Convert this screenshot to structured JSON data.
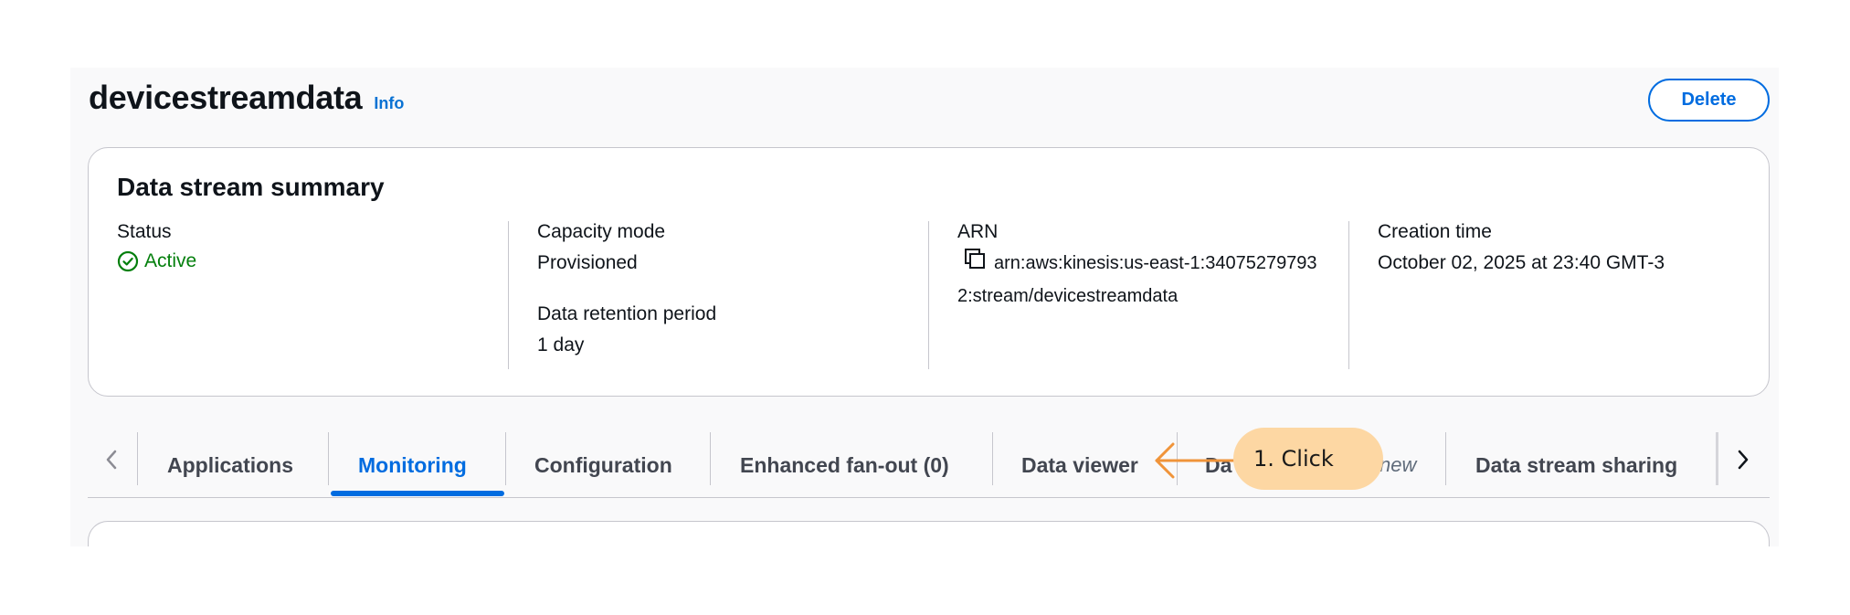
{
  "header": {
    "title": "devicestreamdata",
    "info_link": "Info",
    "delete_label": "Delete"
  },
  "summary": {
    "title": "Data stream summary",
    "status_label": "Status",
    "status_value": "Active",
    "capacity_label": "Capacity mode",
    "capacity_value": "Provisioned",
    "retention_label": "Data retention period",
    "retention_value": "1 day",
    "arn_label": "ARN",
    "arn_value": "arn:aws:kinesis:us-east-1:340752797932:stream/devicestreamdata",
    "creation_label": "Creation time",
    "creation_value": "October 02, 2025 at 23:40 GMT-3"
  },
  "tabs": [
    {
      "label": "Applications"
    },
    {
      "label": "Monitoring"
    },
    {
      "label": "Configuration"
    },
    {
      "label": "Enhanced fan-out (0)"
    },
    {
      "label": "Data viewer"
    },
    {
      "label": "Da"
    },
    {
      "label": "new"
    },
    {
      "label": "Data stream sharing"
    }
  ],
  "active_tab": "Monitoring",
  "annotation": {
    "text": "1. Click"
  },
  "colors": {
    "accent": "#006ce0",
    "status_ok": "#037f0c",
    "callout": "#fdd7a3",
    "callout_arrow": "#f0943a"
  }
}
